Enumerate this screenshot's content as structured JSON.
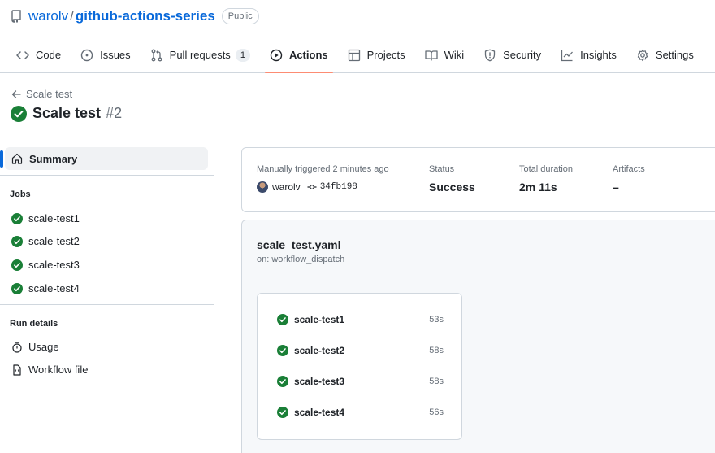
{
  "repo": {
    "owner": "warolv",
    "separator": "/",
    "name": "github-actions-series",
    "visibility": "Public"
  },
  "nav": [
    {
      "label": "Code",
      "icon": "code-icon"
    },
    {
      "label": "Issues",
      "icon": "issue-icon"
    },
    {
      "label": "Pull requests",
      "icon": "pull-request-icon",
      "count": "1"
    },
    {
      "label": "Actions",
      "icon": "play-icon",
      "active": true
    },
    {
      "label": "Projects",
      "icon": "table-icon"
    },
    {
      "label": "Wiki",
      "icon": "book-icon"
    },
    {
      "label": "Security",
      "icon": "shield-icon"
    },
    {
      "label": "Insights",
      "icon": "graph-icon"
    },
    {
      "label": "Settings",
      "icon": "gear-icon"
    }
  ],
  "run": {
    "back_label": "Scale test",
    "title": "Scale test",
    "number": "#2"
  },
  "sidebar": {
    "summary_label": "Summary",
    "jobs_heading": "Jobs",
    "jobs": [
      "scale-test1",
      "scale-test2",
      "scale-test3",
      "scale-test4"
    ],
    "run_details_heading": "Run details",
    "details": [
      {
        "label": "Usage",
        "icon": "stopwatch-icon"
      },
      {
        "label": "Workflow file",
        "icon": "file-code-icon"
      }
    ]
  },
  "summary": {
    "trigger_label": "Manually triggered 2 minutes ago",
    "actor": "warolv",
    "commit": "34fb198",
    "status_label": "Status",
    "status_value": "Success",
    "duration_label": "Total duration",
    "duration_value": "2m 11s",
    "artifacts_label": "Artifacts",
    "artifacts_value": "–"
  },
  "workflow": {
    "file": "scale_test.yaml",
    "trigger": "on: workflow_dispatch",
    "jobs": [
      {
        "name": "scale-test1",
        "duration": "53s"
      },
      {
        "name": "scale-test2",
        "duration": "58s"
      },
      {
        "name": "scale-test3",
        "duration": "58s"
      },
      {
        "name": "scale-test4",
        "duration": "56s"
      }
    ]
  },
  "colors": {
    "success": "#1a7f37",
    "link": "#0969da",
    "active_underline": "#fd8c73",
    "border": "#d0d7de"
  }
}
